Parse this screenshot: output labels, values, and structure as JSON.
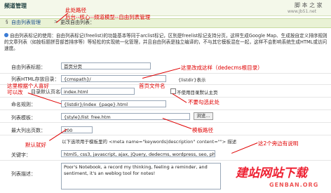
{
  "header": {
    "title": "频道管理",
    "brand": "脚 本 之 家",
    "url": "www.Jb51.net"
  },
  "breadcrumb": {
    "link": "自由列表管理",
    "separator": ">",
    "current": "更改自由列表："
  },
  "description": "自由列表标记的使用：自由列表标记(freelist)的功能基本等同于arclist标记，区别是freelist标记支持分页，这样生成Google Map、生成按自定义排序规则的文章列表（如按标题拼音部首排序等）等轻松的实现统一化管理，并且自由列表是独立编译的，不与其它模板混在一起，这样不会影响系统生成HTML或访问速度。",
  "form": {
    "title_label": "自由列表标题：",
    "title_value": "首页分页",
    "dir_label": "列表HTML存放目录：",
    "dir_value": "{cmspath}/",
    "dir_hint": "{listdir}表示",
    "index_label": "目录默认页名称：",
    "index_value": "index.html",
    "index_checkbox": "不使用目录默认主页",
    "naming_label": "命名规则：",
    "naming_value": "{listdir}/index_{page}.html",
    "template_label": "列表模板：",
    "template_value": "{style}/list_free.htm",
    "browse_button": "浏览...",
    "maxpage_label": "最大列出页数：",
    "maxpage_value": "100",
    "meta_note": "以下选项用于模板里的 <meta name=\"keywords|description\" content=\"\"> 描述",
    "keywords_label": "关键字：",
    "keywords_value": "html5, css3, javascript, ajax, jQuery, dedecms, wordpress, seo, php, w",
    "desc_label": "列表描述：",
    "desc_value": "Poor's Notebook, a record my thinking, feeling a reminder, and sentiment, it's an weblog tool for notes!"
  },
  "annotations": {
    "top1": "此处路径",
    "top2": "后台--核心--频道模型--自由列表管理",
    "dir_note": "这里改成这样（dedecms根目录）",
    "left_note1": "这里根据个人喜好",
    "left_note2": "可以改",
    "index_note": "首页文件名",
    "checkbox_note": "不要勾选此处",
    "template_note": "模板路径",
    "maxpage_note": "默认就好",
    "right_note": "这2个旁边有说明"
  },
  "watermark": {
    "main": "建站网站下载",
    "sub": "GENBAN.ORG"
  }
}
